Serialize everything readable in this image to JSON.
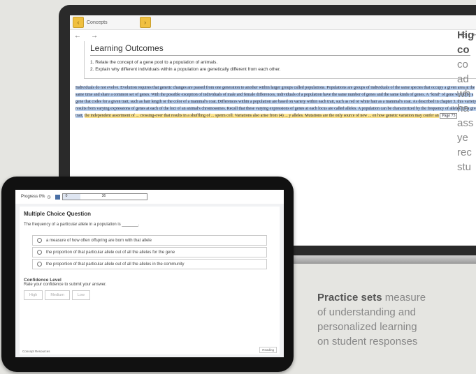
{
  "laptop": {
    "toolbar_tab": "Concepts",
    "nav_icons": [
      "back-arrow-icon",
      "forward-arrow-icon",
      "share-icon",
      "exit-icon"
    ],
    "learning_outcomes": {
      "title": "Learning Outcomes",
      "items": [
        "1. Relate the concept of a gene pool to a population of animals.",
        "2. Explain why different individuals within a population are genetically different from each other."
      ]
    },
    "body_blue": "Individuals do not evolve. Evolution requires that genetic changes are passed from one generation to another within larger groups called populations. Populations are groups of individuals of the same species that occupy a given area at the same time and share a common set of genes. With the possible exception of individuals of male and female differences, individuals of a population have the same number of genes and the same kinds of genes. A \"kind\" of gene would be a gene that codes for a given trait, such as hair length or the color of a mammal's coat. Differences within a population are based on variety within each trait, such as red or white hair as a mammal's coat. As described in chapter 3, this variety results from varying expressions of genes at each of the loci of an animal's chromosomes. Recall that these varying expressions of genes at each locus are called alleles. A population can be characterized by the frequency of alleles for a given trait,",
    "body_yellow": "the independent assortment of ... crossing-over that results in a shuffling of ... sperm cell. Variations also arise from (4) ... y alleles. Mutations are the only source of new ... en how genetic variation may confer an",
    "page_ref": "Page 73",
    "side_label_lines": [
      "Hig",
      "co",
      "co",
      "ad",
      "wh",
      "ha",
      "ass",
      "ye",
      "rec",
      "stu"
    ],
    "side_bold_lines": 2
  },
  "tablet": {
    "progress_label": "Progress 0%",
    "progress_num1": "0",
    "progress_num2": "36",
    "heading": "Multiple Choice Question",
    "question": "The frequency of a particular allele in a population is _______.",
    "options": [
      "a measure of how often offspring are born with that allele",
      "the proportion of that particular allele out of all the alleles for the gene",
      "the proportion of that particular allele out of all the alleles in the community"
    ],
    "confidence_title": "Confidence Level",
    "confidence_sub": "Rate your confidence to submit your answer.",
    "confidence_buttons": [
      "High",
      "Medium",
      "Low"
    ],
    "footer_left": "Concept Resources",
    "footer_right": "Reading"
  },
  "caption": {
    "bold": "Practice sets",
    "lines": [
      "Practice sets measure",
      "of understanding and",
      "personalized learning",
      "on student responses"
    ]
  },
  "colors": {
    "blue_highlight": "#bcd2ef",
    "yellow_highlight": "#fbe38e",
    "gold_button": "#f0c040"
  }
}
